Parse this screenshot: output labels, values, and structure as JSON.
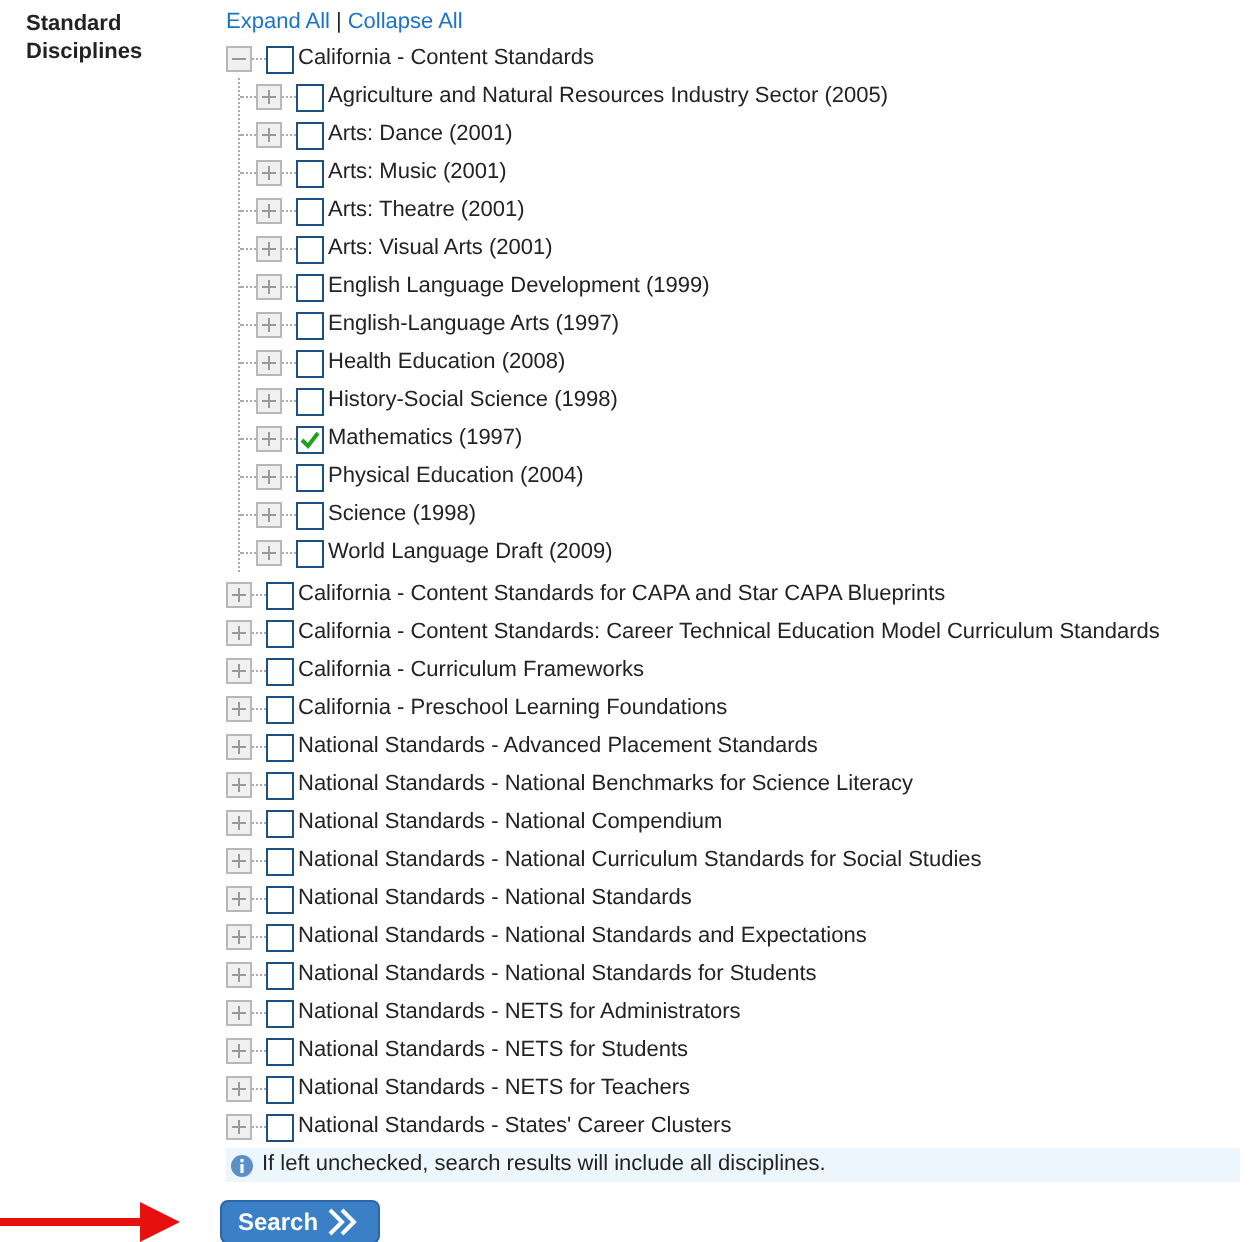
{
  "field_label": "Standard Disciplines",
  "links": [
    {
      "label": "Expand All"
    },
    {
      "separator": "|"
    },
    {
      "label": "Collapse All"
    }
  ],
  "tree": [
    {
      "label": "California - Content Standards",
      "checked": false,
      "expanded": true,
      "children": [
        {
          "label": "Agriculture and Natural Resources Industry Sector (2005)",
          "checked": false,
          "expanded": false
        },
        {
          "label": "Arts: Dance (2001)",
          "checked": false,
          "expanded": false
        },
        {
          "label": "Arts: Music (2001)",
          "checked": false,
          "expanded": false
        },
        {
          "label": "Arts: Theatre (2001)",
          "checked": false,
          "expanded": false
        },
        {
          "label": "Arts: Visual Arts (2001)",
          "checked": false,
          "expanded": false
        },
        {
          "label": "English Language Development (1999)",
          "checked": false,
          "expanded": false
        },
        {
          "label": "English-Language Arts (1997)",
          "checked": false,
          "expanded": false
        },
        {
          "label": "Health Education (2008)",
          "checked": false,
          "expanded": false
        },
        {
          "label": "History-Social Science (1998)",
          "checked": false,
          "expanded": false
        },
        {
          "label": "Mathematics (1997)",
          "checked": true,
          "expanded": false
        },
        {
          "label": "Physical Education (2004)",
          "checked": false,
          "expanded": false
        },
        {
          "label": "Science (1998)",
          "checked": false,
          "expanded": false
        },
        {
          "label": "World Language Draft (2009)",
          "checked": false,
          "expanded": false
        }
      ]
    },
    {
      "label": "California - Content Standards for CAPA and Star CAPA Blueprints",
      "checked": false,
      "expanded": false
    },
    {
      "label": "California - Content Standards: Career Technical Education Model Curriculum Standards",
      "checked": false,
      "expanded": false
    },
    {
      "label": "California - Curriculum Frameworks",
      "checked": false,
      "expanded": false
    },
    {
      "label": "California - Preschool Learning Foundations",
      "checked": false,
      "expanded": false
    },
    {
      "label": "National Standards - Advanced Placement Standards",
      "checked": false,
      "expanded": false
    },
    {
      "label": "National Standards - National Benchmarks for Science Literacy",
      "checked": false,
      "expanded": false
    },
    {
      "label": "National Standards - National Compendium",
      "checked": false,
      "expanded": false
    },
    {
      "label": "National Standards - National Curriculum Standards for Social Studies",
      "checked": false,
      "expanded": false
    },
    {
      "label": "National Standards - National Standards",
      "checked": false,
      "expanded": false
    },
    {
      "label": "National Standards - National Standards and Expectations",
      "checked": false,
      "expanded": false
    },
    {
      "label": "National Standards - National Standards for Students",
      "checked": false,
      "expanded": false
    },
    {
      "label": "National Standards - NETS for Administrators",
      "checked": false,
      "expanded": false
    },
    {
      "label": "National Standards - NETS for Students",
      "checked": false,
      "expanded": false
    },
    {
      "label": "National Standards - NETS for Teachers",
      "checked": false,
      "expanded": false
    },
    {
      "label": "National Standards - States' Career Clusters",
      "checked": false,
      "expanded": false
    }
  ],
  "info_note": "If left unchecked, search results will include all disciplines.",
  "search_button": "Search"
}
